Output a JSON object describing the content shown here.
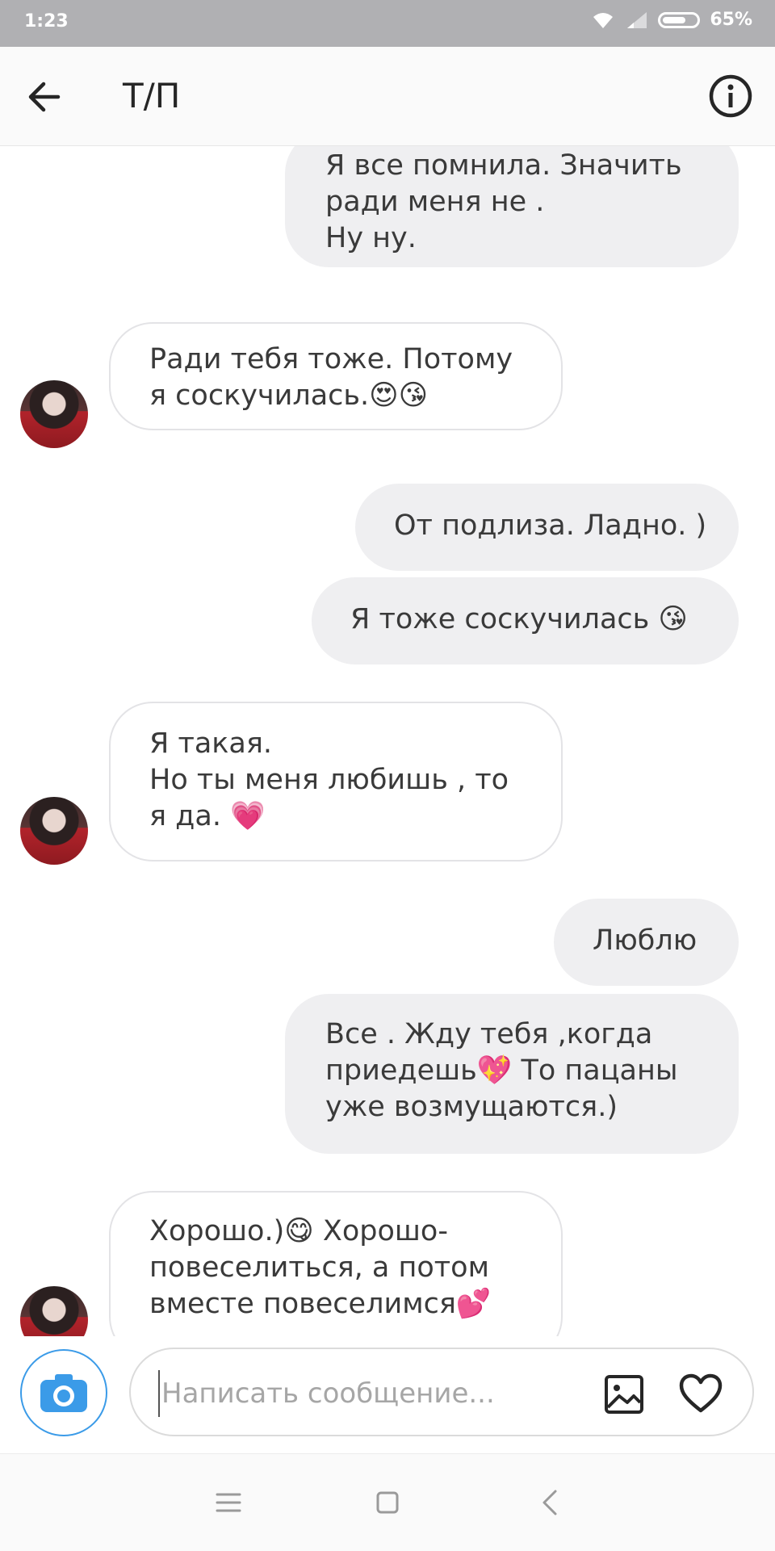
{
  "status_bar": {
    "time": "1:23",
    "battery": "65%"
  },
  "header": {
    "title": "Т/П"
  },
  "messages": [
    {
      "dir": "out",
      "text": "Я все помнила.  Значить\nради меня не .\nНу ну."
    },
    {
      "dir": "in",
      "text": "Ради тебя тоже. Потому\nя соскучилась.😍😘"
    },
    {
      "dir": "out",
      "text": "От подлиза. Ладно. )"
    },
    {
      "dir": "out",
      "text": "Я тоже соскучилась 😘"
    },
    {
      "dir": "in",
      "text": "Я такая.\nНо ты меня любишь , то\nя да. 💗"
    },
    {
      "dir": "out",
      "text": "Люблю"
    },
    {
      "dir": "out",
      "text": "Все . Жду тебя ,когда\nприедешь💖 То пацаны\nуже возмущаются.)"
    },
    {
      "dir": "in",
      "text": "Хорошо.)😋 Хорошо-\nповеселиться, а потом\nвместе повеселимся💕"
    }
  ],
  "composer": {
    "placeholder": "Написать сообщение..."
  },
  "icons": {
    "back": "arrow-left-icon",
    "info": "info-icon",
    "camera": "camera-icon",
    "gallery": "gallery-icon",
    "heart": "heart-icon",
    "menu": "menu-icon",
    "home": "home-square-icon",
    "nav_back": "chevron-left-icon"
  },
  "colors": {
    "accent": "#3b9be8",
    "bubble_out": "#efeff1",
    "bubble_in_border": "#e3e3e6"
  }
}
